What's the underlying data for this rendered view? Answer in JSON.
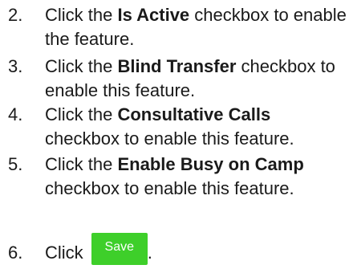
{
  "steps": [
    {
      "num": "2.",
      "pre": "Click the ",
      "bold": "Is Active",
      "post": " checkbox to enable the feature."
    },
    {
      "num": "3.",
      "pre": "Click the ",
      "bold": "Blind Transfer",
      "post": " checkbox to enable this feature."
    },
    {
      "num": "4.",
      "pre": "Click the ",
      "bold": "Consultative Calls",
      "post": " checkbox to enable this feature."
    },
    {
      "num": "5.",
      "pre": "Click the ",
      "bold": "Enable Busy on Camp",
      "post": " checkbox to enable this feature."
    },
    {
      "num": "6.",
      "pre": "Click ",
      "button": "Save",
      "post": "."
    }
  ],
  "colors": {
    "save_button": "#3ecf2a"
  }
}
